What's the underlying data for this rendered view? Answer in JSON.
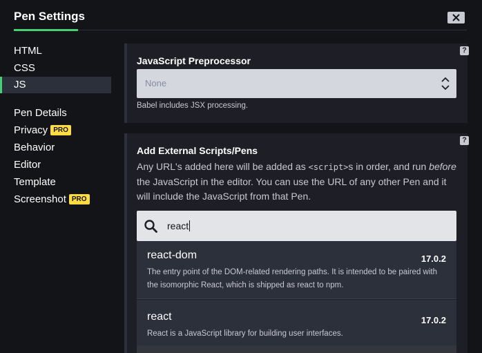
{
  "header": {
    "title": "Pen Settings",
    "close_label": "close"
  },
  "sidebar": {
    "items": [
      {
        "label": "HTML"
      },
      {
        "label": "CSS"
      },
      {
        "label": "JS",
        "active": true
      },
      {
        "label": "Pen Details"
      },
      {
        "label": "Privacy",
        "badge": "PRO"
      },
      {
        "label": "Behavior"
      },
      {
        "label": "Editor"
      },
      {
        "label": "Template"
      },
      {
        "label": "Screenshot",
        "badge": "PRO"
      }
    ]
  },
  "preprocessor": {
    "title": "JavaScript Preprocessor",
    "selected": "None",
    "hint": "Babel includes JSX processing.",
    "help": "?"
  },
  "external": {
    "title": "Add External Scripts/Pens",
    "help": "?",
    "desc_part1": "Any URL's added here will be added as ",
    "desc_code": "<script>",
    "desc_part2": "s in order, and run ",
    "desc_em": "before",
    "desc_part3": " the JavaScript in the editor. You can use the URL of any other Pen and it will include the JavaScript from that Pen.",
    "search_value": "react",
    "results": [
      {
        "name": "react-dom",
        "version": "17.0.2",
        "description": "The entry point of the DOM-related rendering paths. It is intended to be paired with the isomorphic React, which is shipped as react to npm."
      },
      {
        "name": "react",
        "version": "17.0.2",
        "description": "React is a JavaScript library for building user interfaces."
      }
    ]
  },
  "colors": {
    "accent": "#47cf73",
    "pro_badge": "#ffdd40",
    "panel": "#1e1f26",
    "background": "#131417"
  }
}
